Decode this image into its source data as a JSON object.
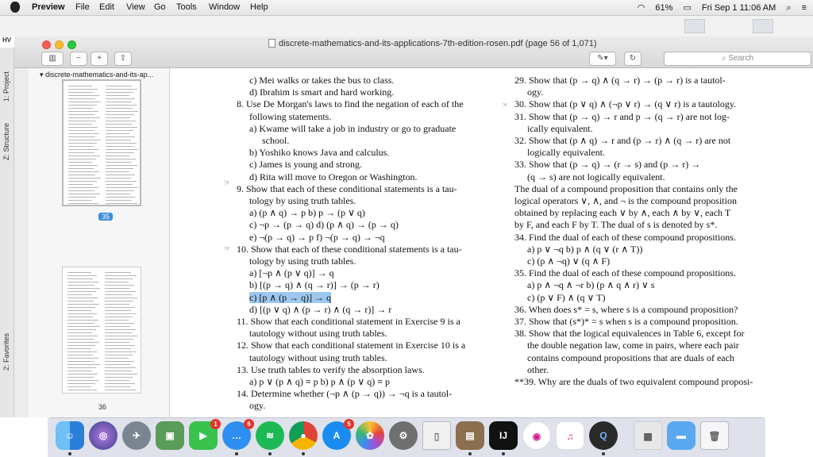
{
  "menubar": {
    "app": "Preview",
    "items": [
      "File",
      "Edit",
      "View",
      "Go",
      "Tools",
      "Window",
      "Help"
    ],
    "battery": "61%",
    "datetime": "Fri Sep 1  11:06 AM"
  },
  "window": {
    "title": "discrete-mathematics-and-its-applications-7th-edition-rosen.pdf (page 56 of 1,071)",
    "search_placeholder": "Search"
  },
  "ide": {
    "project_label": "HV",
    "tabs": [
      "1: Project",
      "Z: Structure",
      "2: Favorites"
    ]
  },
  "sidebar": {
    "file_title": "discrete-mathematics-and-its-ap...",
    "selected_page": "35",
    "current_page": "36"
  },
  "document": {
    "left_column": [
      {
        "text": "c)  Mei walks or takes the bus to class.",
        "indent": 1
      },
      {
        "text": "d)  Ibrahim is smart and hard working.",
        "indent": 1
      },
      {
        "text": "8.  Use De Morgan's laws to find the negation of each of the",
        "indent": 0
      },
      {
        "text": "following statements.",
        "indent": 1
      },
      {
        "text": "a)  Kwame will take a job in industry or go to graduate",
        "indent": 1
      },
      {
        "text": "school.",
        "indent": 2
      },
      {
        "text": "b)  Yoshiko knows Java and calculus.",
        "indent": 1
      },
      {
        "text": "c)  James is young and strong.",
        "indent": 1
      },
      {
        "text": "d)  Rita will move to Oregon or Washington.",
        "indent": 1
      },
      {
        "text": "9.  Show that each of these conditional statements is a tau-",
        "indent": 0
      },
      {
        "text": "tology by using truth tables.",
        "indent": 1
      },
      {
        "text": "a)  (p ∧ q) → p                    b)  p → (p ∨ q)",
        "indent": 1
      },
      {
        "text": "c)  ¬p → (p → q)                d)  (p ∧ q) → (p → q)",
        "indent": 1
      },
      {
        "text": "e)  ¬(p → q) → p                f)  ¬(p → q) → ¬q",
        "indent": 1
      },
      {
        "text": "10.  Show that each of these conditional statements is a tau-",
        "indent": 0
      },
      {
        "text": "tology by using truth tables.",
        "indent": 1
      },
      {
        "text": "a)  [¬p ∧ (p ∨ q)] → q",
        "indent": 1
      },
      {
        "text": "b)  [(p → q) ∧ (q → r)] → (p → r)",
        "indent": 1
      },
      {
        "text": "c)  [p ∧ (p → q)] → q",
        "indent": 1,
        "highlight": true
      },
      {
        "text": "d)  [(p ∨ q) ∧ (p → r) ∧ (q → r)] → r",
        "indent": 1
      },
      {
        "text": "11.  Show that each conditional statement in Exercise 9 is a",
        "indent": 0
      },
      {
        "text": "tautology without using truth tables.",
        "indent": 1
      },
      {
        "text": "12.  Show that each conditional statement in Exercise 10 is a",
        "indent": 0
      },
      {
        "text": "tautology without using truth tables.",
        "indent": 1
      },
      {
        "text": "13.  Use truth tables to verify the absorption laws.",
        "indent": 0
      },
      {
        "text": "a)  p ∨ (p ∧ q) ≡ p               b)  p ∧ (p ∨ q) ≡ p",
        "indent": 1
      },
      {
        "text": "14.  Determine whether (¬p ∧ (p → q)) → ¬q is a tautol-",
        "indent": 0
      },
      {
        "text": "ogy.",
        "indent": 1
      }
    ],
    "right_column": [
      {
        "text": "29.  Show that (p → q) ∧ (q → r) → (p → r) is a tautol-",
        "indent": 0
      },
      {
        "text": "ogy.",
        "indent": 1
      },
      {
        "text": "30.  Show that (p ∨ q) ∧ (¬p ∨ r) → (q ∨ r) is a tautology.",
        "indent": 0
      },
      {
        "text": "31.  Show that (p → q) → r and p → (q → r) are not log-",
        "indent": 0
      },
      {
        "text": "ically equivalent.",
        "indent": 1
      },
      {
        "text": "32.  Show that (p ∧ q) → r and (p → r) ∧ (q → r) are not",
        "indent": 0
      },
      {
        "text": "logically equivalent.",
        "indent": 1
      },
      {
        "text": "33.  Show    that    (p → q) → (r → s)    and    (p → r) →",
        "indent": 0
      },
      {
        "text": "(q → s) are not logically equivalent.",
        "indent": 1
      },
      {
        "text": "The dual of a compound proposition that contains only the",
        "indent": 0
      },
      {
        "text": "logical operators ∨, ∧, and ¬ is the compound proposition",
        "indent": 0
      },
      {
        "text": "obtained by replacing each ∨ by ∧, each ∧ by ∨, each T",
        "indent": 0
      },
      {
        "text": "by F, and each F by T. The dual of s is denoted by s*.",
        "indent": 0
      },
      {
        "text": "34.  Find the dual of each of these compound propositions.",
        "indent": 0
      },
      {
        "text": "a)  p ∨ ¬q                         b)  p ∧ (q ∨ (r ∧ T))",
        "indent": 1
      },
      {
        "text": "c)  (p ∧ ¬q) ∨ (q ∧ F)",
        "indent": 1
      },
      {
        "text": "35.  Find the dual of each of these compound propositions.",
        "indent": 0
      },
      {
        "text": "a)  p ∧ ¬q ∧ ¬r                  b)  (p ∧ q ∧ r) ∨ s",
        "indent": 1
      },
      {
        "text": "c)  (p ∨ F) ∧ (q ∨ T)",
        "indent": 1
      },
      {
        "text": "36.  When does s* = s, where s is a compound proposition?",
        "indent": 0
      },
      {
        "text": "37.  Show that (s*)* = s when s is a compound proposition.",
        "indent": 0
      },
      {
        "text": "38.  Show that the logical equivalences in Table 6, except for",
        "indent": 0
      },
      {
        "text": "the double negation law, come in pairs, where each pair",
        "indent": 1
      },
      {
        "text": "contains compound propositions that are duals of each",
        "indent": 1
      },
      {
        "text": "other.",
        "indent": 1
      },
      {
        "text": "**39.  Why are the duals of two equivalent compound proposi-",
        "indent": 0
      }
    ]
  },
  "dock": {
    "badges": {
      "facetime": "1",
      "messages": "6",
      "appstore": "5"
    },
    "intellij_label": "IJ"
  }
}
